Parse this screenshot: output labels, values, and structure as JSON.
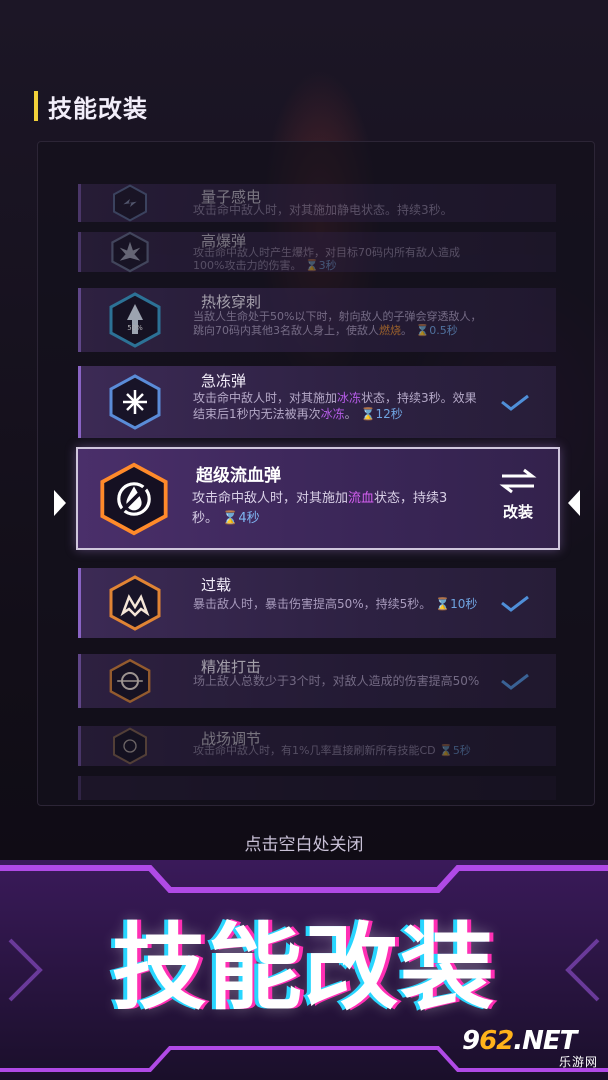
{
  "header": {
    "title": "技能改装"
  },
  "skills": [
    {
      "name": "量子感电",
      "desc": "攻击命中敌人时，对其施加静电状态。持续3秒。",
      "state": "dim"
    },
    {
      "name": "高爆弹",
      "desc": "攻击命中敌人时产生爆炸，对目标70码内所有敌人造成100%攻击力的伤害。",
      "cooldown": "3秒",
      "state": "dim"
    },
    {
      "name": "热核穿刺",
      "desc_pre": "当敌人生命处于50%以下时，射向敌人的子弹会穿透敌人，跳向70码内其他3名敌人身上，使敌人",
      "highlight": "燃烧",
      "desc_post": "。",
      "cooldown": "0.5秒",
      "state": "semi"
    },
    {
      "name": "急冻弹",
      "desc_pre": "攻击命中敌人时，对其施加",
      "highlight": "冰冻",
      "desc_mid": "状态，持续3秒。效果结束后1秒内无法被再次",
      "highlight2": "冰冻",
      "desc_post": "。",
      "cooldown": "12秒",
      "equipped": true
    },
    {
      "name": "过载",
      "desc": "暴击敌人时，暴击伤害提高50%，持续5秒。",
      "cooldown": "10秒",
      "equipped": true
    },
    {
      "name": "精准打击",
      "desc": "场上敌人总数少于3个时，对敌人造成的伤害提高50%",
      "equipped": true,
      "state": "semi"
    },
    {
      "name": "战场调节",
      "desc": "攻击命中敌人时，有1%几率直接刷新所有技能CD",
      "cooldown": "5秒",
      "state": "dim"
    }
  ],
  "selected": {
    "name": "超级流血弹",
    "desc_pre": "攻击命中敌人时，对其施加",
    "highlight": "流血",
    "desc_post": "状态，持续3秒。",
    "cooldown": "4秒",
    "swap_label": "改装"
  },
  "close_hint": "点击空白处关闭",
  "banner_title": "技能改装",
  "watermark": {
    "logo_prefix": "9",
    "logo_num": "62",
    "logo_suffix": ".NET",
    "sub": "乐游网"
  },
  "colors": {
    "accent": "#f2d13a",
    "highlight": "#d45ff0",
    "check": "#4f8fd8"
  }
}
